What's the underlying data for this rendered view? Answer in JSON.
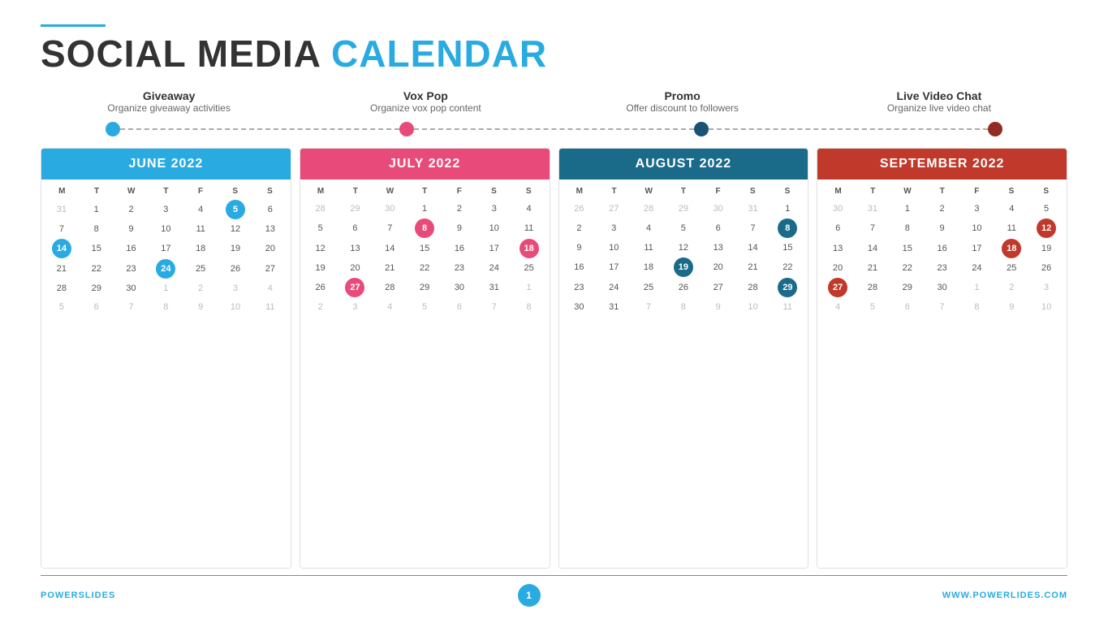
{
  "header": {
    "line_color": "#29abe2",
    "title_black": "SOCIAL MEDIA",
    "title_accent": "CALENDAR"
  },
  "categories": [
    {
      "id": "giveaway",
      "title": "Giveaway",
      "subtitle": "Organize giveaway activities",
      "dot_class": "blue",
      "dot_position": "first"
    },
    {
      "id": "vox-pop",
      "title": "Vox Pop",
      "subtitle": "Organize vox pop content",
      "dot_class": "pink",
      "dot_position": "second"
    },
    {
      "id": "promo",
      "title": "Promo",
      "subtitle": "Offer discount to followers",
      "dot_class": "darkblue",
      "dot_position": "third"
    },
    {
      "id": "live-video",
      "title": "Live Video Chat",
      "subtitle": "Organize live video chat",
      "dot_class": "darkred",
      "dot_position": "fourth"
    }
  ],
  "calendars": [
    {
      "id": "june",
      "month": "JUNE 2022",
      "header_class": "blue-bg",
      "days": [
        "M",
        "T",
        "W",
        "T",
        "F",
        "S",
        "S"
      ],
      "cells": [
        {
          "num": "31",
          "class": "other-month"
        },
        {
          "num": "1",
          "class": ""
        },
        {
          "num": "2",
          "class": ""
        },
        {
          "num": "3",
          "class": ""
        },
        {
          "num": "4",
          "class": ""
        },
        {
          "num": "5",
          "class": "highlighted-blue"
        },
        {
          "num": "6",
          "class": ""
        },
        {
          "num": "7",
          "class": ""
        },
        {
          "num": "8",
          "class": ""
        },
        {
          "num": "9",
          "class": ""
        },
        {
          "num": "10",
          "class": ""
        },
        {
          "num": "11",
          "class": ""
        },
        {
          "num": "12",
          "class": ""
        },
        {
          "num": "13",
          "class": ""
        },
        {
          "num": "14",
          "class": "highlighted-blue"
        },
        {
          "num": "15",
          "class": ""
        },
        {
          "num": "16",
          "class": ""
        },
        {
          "num": "17",
          "class": ""
        },
        {
          "num": "18",
          "class": ""
        },
        {
          "num": "19",
          "class": ""
        },
        {
          "num": "20",
          "class": ""
        },
        {
          "num": "21",
          "class": ""
        },
        {
          "num": "22",
          "class": ""
        },
        {
          "num": "23",
          "class": ""
        },
        {
          "num": "24",
          "class": "highlighted-blue"
        },
        {
          "num": "25",
          "class": ""
        },
        {
          "num": "26",
          "class": ""
        },
        {
          "num": "27",
          "class": ""
        },
        {
          "num": "28",
          "class": ""
        },
        {
          "num": "29",
          "class": ""
        },
        {
          "num": "30",
          "class": ""
        },
        {
          "num": "1",
          "class": "other-month"
        },
        {
          "num": "2",
          "class": "other-month"
        },
        {
          "num": "3",
          "class": "other-month"
        },
        {
          "num": "4",
          "class": "other-month"
        },
        {
          "num": "5",
          "class": "other-month"
        },
        {
          "num": "6",
          "class": "other-month"
        },
        {
          "num": "7",
          "class": "other-month"
        },
        {
          "num": "8",
          "class": "other-month"
        },
        {
          "num": "9",
          "class": "other-month"
        },
        {
          "num": "10",
          "class": "other-month"
        },
        {
          "num": "11",
          "class": "other-month"
        }
      ]
    },
    {
      "id": "july",
      "month": "JULY 2022",
      "header_class": "pink-bg",
      "days": [
        "M",
        "T",
        "W",
        "T",
        "F",
        "S",
        "S"
      ],
      "cells": [
        {
          "num": "28",
          "class": "other-month"
        },
        {
          "num": "29",
          "class": "other-month"
        },
        {
          "num": "30",
          "class": "other-month"
        },
        {
          "num": "1",
          "class": ""
        },
        {
          "num": "2",
          "class": ""
        },
        {
          "num": "3",
          "class": ""
        },
        {
          "num": "4",
          "class": ""
        },
        {
          "num": "5",
          "class": ""
        },
        {
          "num": "6",
          "class": ""
        },
        {
          "num": "7",
          "class": ""
        },
        {
          "num": "8",
          "class": "highlighted-pink"
        },
        {
          "num": "9",
          "class": ""
        },
        {
          "num": "10",
          "class": ""
        },
        {
          "num": "11",
          "class": ""
        },
        {
          "num": "12",
          "class": ""
        },
        {
          "num": "13",
          "class": ""
        },
        {
          "num": "14",
          "class": ""
        },
        {
          "num": "15",
          "class": ""
        },
        {
          "num": "16",
          "class": ""
        },
        {
          "num": "17",
          "class": ""
        },
        {
          "num": "18",
          "class": "highlighted-pink"
        },
        {
          "num": "19",
          "class": ""
        },
        {
          "num": "20",
          "class": ""
        },
        {
          "num": "21",
          "class": ""
        },
        {
          "num": "22",
          "class": ""
        },
        {
          "num": "23",
          "class": ""
        },
        {
          "num": "24",
          "class": ""
        },
        {
          "num": "25",
          "class": ""
        },
        {
          "num": "26",
          "class": ""
        },
        {
          "num": "27",
          "class": "highlighted-pink"
        },
        {
          "num": "28",
          "class": ""
        },
        {
          "num": "29",
          "class": ""
        },
        {
          "num": "30",
          "class": ""
        },
        {
          "num": "31",
          "class": ""
        },
        {
          "num": "1",
          "class": "other-month"
        },
        {
          "num": "2",
          "class": "other-month"
        },
        {
          "num": "3",
          "class": "other-month"
        },
        {
          "num": "4",
          "class": "other-month"
        },
        {
          "num": "5",
          "class": "other-month"
        },
        {
          "num": "6",
          "class": "other-month"
        },
        {
          "num": "7",
          "class": "other-month"
        },
        {
          "num": "8",
          "class": "other-month"
        }
      ]
    },
    {
      "id": "august",
      "month": "AUGUST 2022",
      "header_class": "darkblue-bg",
      "days": [
        "M",
        "T",
        "W",
        "T",
        "F",
        "S",
        "S"
      ],
      "cells": [
        {
          "num": "26",
          "class": "other-month"
        },
        {
          "num": "27",
          "class": "other-month"
        },
        {
          "num": "28",
          "class": "other-month"
        },
        {
          "num": "29",
          "class": "other-month"
        },
        {
          "num": "30",
          "class": "other-month"
        },
        {
          "num": "31",
          "class": "other-month"
        },
        {
          "num": "1",
          "class": ""
        },
        {
          "num": "2",
          "class": ""
        },
        {
          "num": "3",
          "class": ""
        },
        {
          "num": "4",
          "class": ""
        },
        {
          "num": "5",
          "class": ""
        },
        {
          "num": "6",
          "class": ""
        },
        {
          "num": "7",
          "class": ""
        },
        {
          "num": "8",
          "class": "highlighted-darkblue"
        },
        {
          "num": "9",
          "class": ""
        },
        {
          "num": "10",
          "class": ""
        },
        {
          "num": "11",
          "class": ""
        },
        {
          "num": "12",
          "class": ""
        },
        {
          "num": "13",
          "class": ""
        },
        {
          "num": "14",
          "class": ""
        },
        {
          "num": "15",
          "class": ""
        },
        {
          "num": "16",
          "class": ""
        },
        {
          "num": "17",
          "class": ""
        },
        {
          "num": "18",
          "class": ""
        },
        {
          "num": "19",
          "class": "highlighted-darkblue"
        },
        {
          "num": "20",
          "class": ""
        },
        {
          "num": "21",
          "class": ""
        },
        {
          "num": "22",
          "class": ""
        },
        {
          "num": "23",
          "class": ""
        },
        {
          "num": "24",
          "class": ""
        },
        {
          "num": "25",
          "class": ""
        },
        {
          "num": "26",
          "class": ""
        },
        {
          "num": "27",
          "class": ""
        },
        {
          "num": "28",
          "class": ""
        },
        {
          "num": "29",
          "class": "highlighted-darkblue"
        },
        {
          "num": "30",
          "class": ""
        },
        {
          "num": "31",
          "class": ""
        },
        {
          "num": "7",
          "class": "other-month"
        },
        {
          "num": "8",
          "class": "other-month"
        },
        {
          "num": "9",
          "class": "other-month"
        },
        {
          "num": "10",
          "class": "other-month"
        },
        {
          "num": "11",
          "class": "other-month"
        }
      ]
    },
    {
      "id": "september",
      "month": "SEPTEMBER 2022",
      "header_class": "darkred-bg",
      "days": [
        "M",
        "T",
        "W",
        "T",
        "F",
        "S",
        "S"
      ],
      "cells": [
        {
          "num": "30",
          "class": "other-month"
        },
        {
          "num": "31",
          "class": "other-month"
        },
        {
          "num": "1",
          "class": ""
        },
        {
          "num": "2",
          "class": ""
        },
        {
          "num": "3",
          "class": ""
        },
        {
          "num": "4",
          "class": ""
        },
        {
          "num": "5",
          "class": ""
        },
        {
          "num": "6",
          "class": ""
        },
        {
          "num": "7",
          "class": ""
        },
        {
          "num": "8",
          "class": ""
        },
        {
          "num": "9",
          "class": ""
        },
        {
          "num": "10",
          "class": ""
        },
        {
          "num": "11",
          "class": ""
        },
        {
          "num": "12",
          "class": "highlighted-darkred"
        },
        {
          "num": "13",
          "class": ""
        },
        {
          "num": "14",
          "class": ""
        },
        {
          "num": "15",
          "class": ""
        },
        {
          "num": "16",
          "class": ""
        },
        {
          "num": "17",
          "class": ""
        },
        {
          "num": "18",
          "class": "highlighted-darkred"
        },
        {
          "num": "19",
          "class": ""
        },
        {
          "num": "20",
          "class": ""
        },
        {
          "num": "21",
          "class": ""
        },
        {
          "num": "22",
          "class": ""
        },
        {
          "num": "23",
          "class": ""
        },
        {
          "num": "24",
          "class": ""
        },
        {
          "num": "25",
          "class": ""
        },
        {
          "num": "26",
          "class": ""
        },
        {
          "num": "27",
          "class": "highlighted-darkred"
        },
        {
          "num": "28",
          "class": ""
        },
        {
          "num": "29",
          "class": ""
        },
        {
          "num": "30",
          "class": ""
        },
        {
          "num": "1",
          "class": "other-month"
        },
        {
          "num": "2",
          "class": "other-month"
        },
        {
          "num": "3",
          "class": "other-month"
        },
        {
          "num": "4",
          "class": "other-month"
        },
        {
          "num": "5",
          "class": "other-month"
        },
        {
          "num": "6",
          "class": "other-month"
        },
        {
          "num": "7",
          "class": "other-month"
        },
        {
          "num": "8",
          "class": "other-month"
        },
        {
          "num": "9",
          "class": "other-month"
        },
        {
          "num": "10",
          "class": "other-month"
        }
      ]
    }
  ],
  "footer": {
    "left_black": "POWER",
    "left_accent": "SLIDES",
    "page_num": "1",
    "right": "WWW.POWERLIDES.COM"
  }
}
